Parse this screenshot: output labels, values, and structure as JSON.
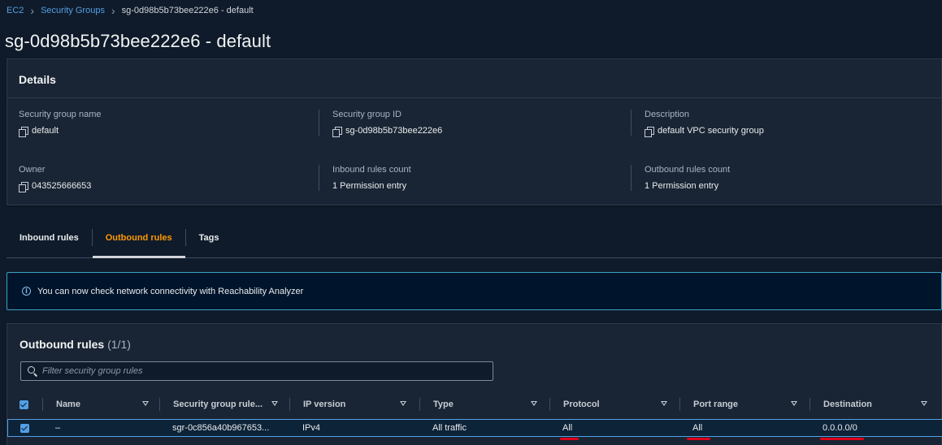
{
  "breadcrumb": {
    "items": [
      "EC2",
      "Security Groups"
    ],
    "current": "sg-0d98b5b73bee222e6 - default"
  },
  "page_title": "sg-0d98b5b73bee222e6 - default",
  "details": {
    "heading": "Details",
    "fields": {
      "sg_name": {
        "label": "Security group name",
        "value": "default"
      },
      "sg_id": {
        "label": "Security group ID",
        "value": "sg-0d98b5b73bee222e6"
      },
      "description": {
        "label": "Description",
        "value": "default VPC security group"
      },
      "owner": {
        "label": "Owner",
        "value": "043525666653"
      },
      "inbound_count": {
        "label": "Inbound rules count",
        "value": "1 Permission entry"
      },
      "outbound_count": {
        "label": "Outbound rules count",
        "value": "1 Permission entry"
      }
    }
  },
  "tabs": [
    "Inbound rules",
    "Outbound rules",
    "Tags"
  ],
  "active_tab": "Outbound rules",
  "flash": {
    "icon": "info-icon",
    "text": "You can now check network connectivity with Reachability Analyzer"
  },
  "rules": {
    "title": "Outbound rules",
    "count": "(1/1)",
    "filter_placeholder": "Filter security group rules",
    "columns": [
      "Name",
      "Security group rule...",
      "IP version",
      "Type",
      "Protocol",
      "Port range",
      "Destination"
    ],
    "rows": [
      {
        "name": "–",
        "rule_id": "sgr-0c856a40b967653...",
        "ip_version": "IPv4",
        "type": "All traffic",
        "protocol": "All",
        "port_range": "All",
        "destination": "0.0.0.0/0"
      }
    ]
  },
  "colors": {
    "accent": "#539fe5",
    "active_tab": "#ff9900",
    "annotation": "#e0001b",
    "background": "#0f1b2a"
  }
}
